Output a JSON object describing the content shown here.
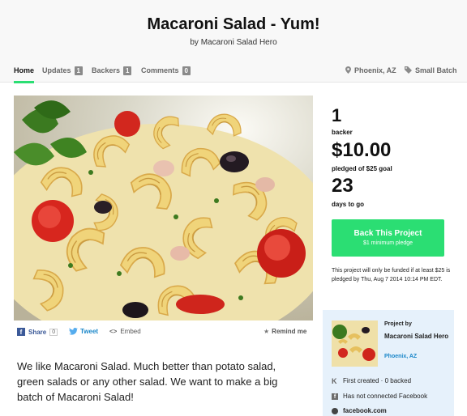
{
  "project": {
    "title": "Macaroni Salad - Yum!",
    "byline": "by Macaroni Salad Hero"
  },
  "nav": {
    "tabs": [
      {
        "label": "Home",
        "count": null
      },
      {
        "label": "Updates",
        "count": "1"
      },
      {
        "label": "Backers",
        "count": "1"
      },
      {
        "label": "Comments",
        "count": "0"
      }
    ],
    "location": "Phoenix, AZ",
    "category": "Small Batch"
  },
  "stats": {
    "backers": "1",
    "backers_label": "backer",
    "pledged": "$10.00",
    "pledged_label": "pledged of $25 goal",
    "days": "23",
    "days_label": "days to go"
  },
  "back_button": {
    "label": "Back This Project",
    "sub": "$1 minimum pledge"
  },
  "funding_note": "This project will only be funded if at least $25 is pledged by Thu, Aug 7 2014 10:14 PM EDT.",
  "share": {
    "share_label": "Share",
    "share_count": "0",
    "tweet_label": "Tweet",
    "embed_label": "Embed",
    "remind_label": "Remind me"
  },
  "description": "We like Macaroni Salad. Much better than potato salad, green salads or any other salad. We want to make a big batch of Macaroni Salad!",
  "creator": {
    "by_label": "Project by",
    "name": "Macaroni Salad Hero",
    "location": "Phoenix, AZ",
    "first_created": "First created · 0 backed",
    "facebook_status": "Has not connected Facebook",
    "website": "facebook.com"
  },
  "colors": {
    "accent_green": "#2bde73",
    "creator_bg": "#e6f1fb",
    "link_blue": "#1b87c9",
    "facebook_blue": "#3b5998",
    "twitter_blue": "#55acee"
  }
}
